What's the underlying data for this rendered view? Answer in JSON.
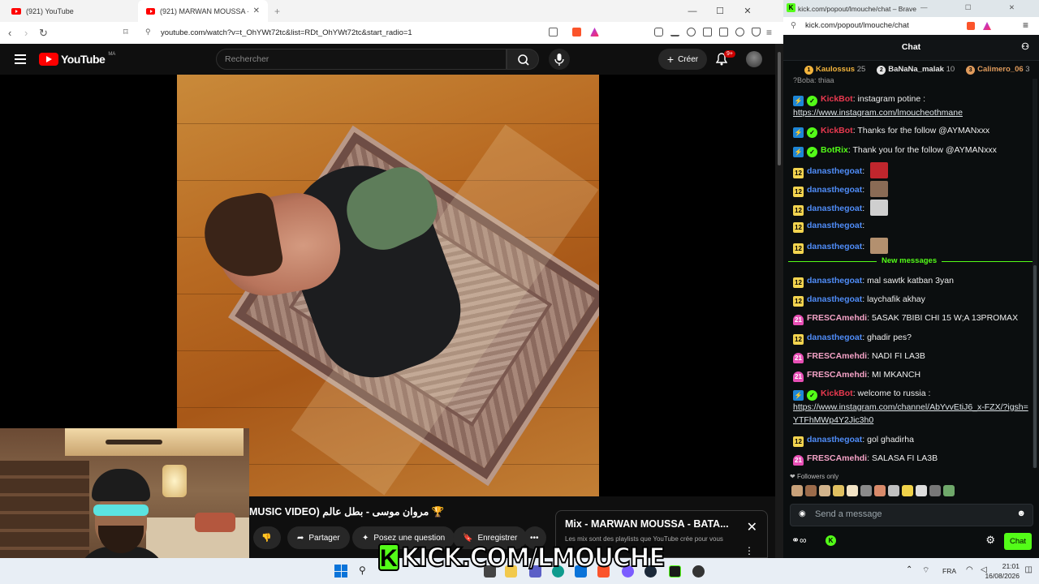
{
  "browser_left": {
    "tabs": [
      {
        "label": "(921) YouTube"
      },
      {
        "label": "(921) MARWAN MOUSSA - B"
      }
    ],
    "url": "youtube.com/watch?v=t_OhYWt72tc&list=RDt_OhYWt72tc&start_radio=1"
  },
  "youtube": {
    "logo_text": "YouTube",
    "country_code": "MA",
    "search_placeholder": "Rechercher",
    "create_label": "Créer",
    "notif_count": "9+",
    "video_title": "مروان موسى - بطل عالم (MUSIC VIDEO",
    "title_prefix_emoji": "🏆",
    "actions": {
      "share": "Partager",
      "ask": "Posez une question",
      "save": "Enregistrer"
    },
    "mix": {
      "title": "Mix - MARWAN MOUSSA - BATA...",
      "subtitle": "Les mix sont des playlists que YouTube crée pour vous"
    }
  },
  "browser_right": {
    "title": "kick.com/popout/lmouche/chat – Brave",
    "url": "kick.com/popout/lmouche/chat"
  },
  "chat": {
    "header": "Chat",
    "leaderboard": [
      {
        "rank": "1",
        "name": "Kaulossus",
        "count": "25",
        "color": "#f3b43c"
      },
      {
        "rank": "2",
        "name": "BaNaNa_malak",
        "count": "10",
        "color": "#e6e6e6"
      },
      {
        "rank": "3",
        "name": "Calimero_06",
        "count": "3",
        "color": "#e09b5c"
      }
    ],
    "partial_top": "?Boba: thiaa",
    "messages": [
      {
        "badges": [
          "bot",
          "ver"
        ],
        "user": "KickBot",
        "color": "#e8394f",
        "text": "instagram potine :",
        "link": "https://www.instagram.com/lmoucheothmane"
      },
      {
        "badges": [
          "bot",
          "ver"
        ],
        "user": "KickBot",
        "color": "#e8394f",
        "text": "Thanks for the follow @AYMANxxx"
      },
      {
        "badges": [
          "bot",
          "ver"
        ],
        "user": "BotRix",
        "color": "#53fc18",
        "text": "Thank you for the follow @AYMANxxx"
      },
      {
        "badges": [
          "sub"
        ],
        "user": "danasthegoat",
        "color": "#4f8cf7",
        "text": "",
        "emote": "#c0262d"
      },
      {
        "badges": [
          "sub"
        ],
        "user": "danasthegoat",
        "color": "#4f8cf7",
        "text": "",
        "emote": "#8a6b55"
      },
      {
        "badges": [
          "sub"
        ],
        "user": "danasthegoat",
        "color": "#4f8cf7",
        "text": "",
        "emote": "#cfcfcf"
      },
      {
        "badges": [
          "sub"
        ],
        "user": "danasthegoat",
        "color": "#4f8cf7",
        "text": ""
      },
      {
        "badges": [
          "sub"
        ],
        "user": "danasthegoat",
        "color": "#4f8cf7",
        "text": "",
        "emote": "#b3906f"
      }
    ],
    "new_messages_label": "New messages",
    "messages_new": [
      {
        "badges": [
          "sub"
        ],
        "user": "danasthegoat",
        "color": "#4f8cf7",
        "text": "mal sawtk katban 3yan"
      },
      {
        "badges": [
          "sub"
        ],
        "user": "danasthegoat",
        "color": "#4f8cf7",
        "text": "laychafik akhay"
      },
      {
        "badges": [
          "pk"
        ],
        "sub_months": "21",
        "user": "FRESCAmehdi",
        "color": "#f5a3c7",
        "text": "5ASAK 7BIBI CHI 15 W;A 13PROMAX"
      },
      {
        "badges": [
          "sub"
        ],
        "user": "danasthegoat",
        "color": "#4f8cf7",
        "text": "ghadir pes?"
      },
      {
        "badges": [
          "pk"
        ],
        "sub_months": "21",
        "user": "FRESCAmehdi",
        "color": "#f5a3c7",
        "text": "NADI FI LA3B"
      },
      {
        "badges": [
          "pk"
        ],
        "sub_months": "21",
        "user": "FRESCAmehdi",
        "color": "#f5a3c7",
        "text": "MI MKANCH"
      },
      {
        "badges": [
          "bot",
          "ver"
        ],
        "user": "KickBot",
        "color": "#e8394f",
        "text": "welcome to russia :",
        "link": "https://www.instagram.com/channel/AbYvvEtiJ6_x-FZX/?igsh=YTFhMWp4Y2Jic3h0"
      },
      {
        "badges": [
          "sub"
        ],
        "user": "danasthegoat",
        "color": "#4f8cf7",
        "text": "gol ghadirha"
      },
      {
        "badges": [
          "pk"
        ],
        "sub_months": "21",
        "user": "FRESCAmehdi",
        "color": "#f5a3c7",
        "text": "SALASA FI LA3B"
      }
    ],
    "followers_only": "Followers only",
    "input_placeholder": "Send a message",
    "send_label": "Chat",
    "sub_badge_text": "12"
  },
  "overlay": {
    "banner_text": "KICK.COM/LMOUCHE",
    "banner_logo": "K"
  },
  "taskbar": {
    "lang": "FRA",
    "time": "21:01",
    "date": "16/08/2026"
  },
  "colors": {
    "kick_green": "#53fc18",
    "yt_red": "#ff0000"
  }
}
